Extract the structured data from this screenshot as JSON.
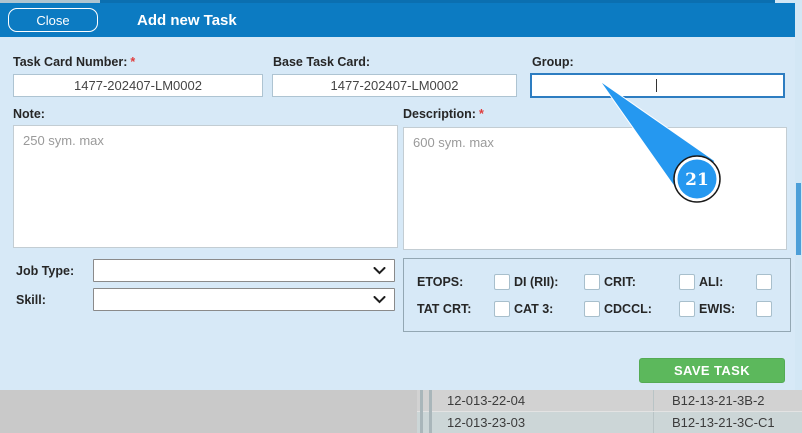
{
  "header": {
    "close_button": "Close",
    "title": "Add new Task"
  },
  "form": {
    "task_card_number": {
      "label": "Task Card Number:",
      "required_mark": "*",
      "value": "1477-202407-LM0002"
    },
    "base_task_card": {
      "label": "Base Task Card:",
      "value": "1477-202407-LM0002"
    },
    "group": {
      "label": "Group:",
      "value": ""
    },
    "note": {
      "label": "Note:",
      "placeholder": "250 sym. max",
      "value": ""
    },
    "description": {
      "label": "Description:",
      "required_mark": "*",
      "placeholder": "600 sym. max",
      "value": ""
    },
    "job_type": {
      "label": "Job Type:",
      "selected": ""
    },
    "skill": {
      "label": "Skill:",
      "selected": ""
    },
    "flags": [
      {
        "label": "ETOPS:",
        "checked": false
      },
      {
        "label": "DI (RII):",
        "checked": false
      },
      {
        "label": "CRIT:",
        "checked": false
      },
      {
        "label": "ALI:",
        "checked": false
      },
      {
        "label": "TAT CRT:",
        "checked": false
      },
      {
        "label": "CAT 3:",
        "checked": false
      },
      {
        "label": "CDCCL:",
        "checked": false
      },
      {
        "label": "EWIS:",
        "checked": false
      }
    ],
    "save_button": "SAVE TASK"
  },
  "annotation": {
    "step_number": "21"
  },
  "background_table": {
    "rows": [
      {
        "task_number": "12-013-22-04",
        "task_card": "B12-13-21-3B-2"
      },
      {
        "task_number": "12-013-23-03",
        "task_card": "B12-13-21-3C-C1"
      }
    ]
  },
  "colors": {
    "header_blue": "#0c7bc2",
    "modal_bg": "#d7e9f7",
    "annotation_blue": "#2598f0",
    "save_green": "#5cb85c",
    "focus_border": "#2d7dc1"
  }
}
